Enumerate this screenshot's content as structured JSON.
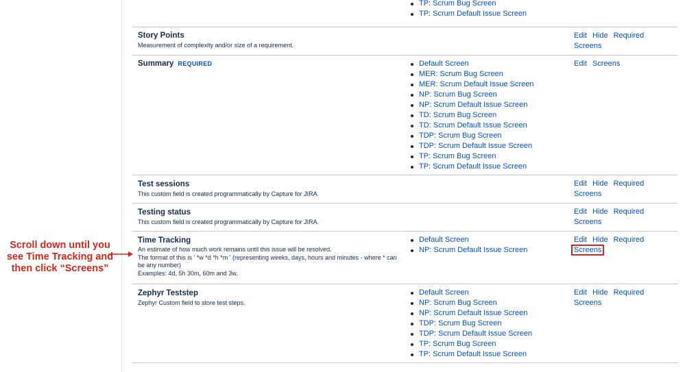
{
  "annotation": {
    "lines": [
      "Scroll down until you",
      "see Time Tracking and",
      "then click “Screens”"
    ]
  },
  "top_partial": {
    "screens": [
      "TP: Scrum Bug Screen",
      "TP: Scrum Default Issue Screen"
    ]
  },
  "fields": [
    {
      "name": "Story Points",
      "description": [
        "Measurement of complexity and/or size of a requirement."
      ],
      "screens": [],
      "ops": {
        "edit": "Edit",
        "hide": "Hide",
        "required": "Required",
        "screens": "Screens"
      }
    },
    {
      "name": "Summary",
      "required_tag": "REQUIRED",
      "description": [],
      "screens": [
        "Default Screen",
        "MER: Scrum Bug Screen",
        "MER: Scrum Default Issue Screen",
        "NP: Scrum Bug Screen",
        "NP: Scrum Default Issue Screen",
        "TD: Scrum Bug Screen",
        "TD: Scrum Default Issue Screen",
        "TDP: Scrum Bug Screen",
        "TDP: Scrum Default Issue Screen",
        "TP: Scrum Bug Screen",
        "TP: Scrum Default Issue Screen"
      ],
      "ops": {
        "edit": "Edit",
        "screens": "Screens"
      }
    },
    {
      "name": "Test sessions",
      "description": [
        "This custom field is created programmatically by Capture for JIRA."
      ],
      "screens": [],
      "ops": {
        "edit": "Edit",
        "hide": "Hide",
        "required": "Required",
        "screens": "Screens"
      }
    },
    {
      "name": "Testing status",
      "description": [
        "This custom field is created programmatically by Capture for JIRA."
      ],
      "screens": [],
      "ops": {
        "edit": "Edit",
        "hide": "Hide",
        "required": "Required",
        "screens": "Screens"
      }
    },
    {
      "name": "Time Tracking",
      "description": [
        "An estimate of how much work remains until this issue will be resolved.",
        "The format of this is ' *w *d *h *m ' (representing weeks, days, hours and minutes - where * can",
        "be any number)",
        "Examples: 4d, 5h 30m, 60m and 3w."
      ],
      "screens": [
        "Default Screen",
        "NP: Scrum Default Issue Screen"
      ],
      "ops": {
        "edit": "Edit",
        "hide": "Hide",
        "required": "Required",
        "screens": "Screens"
      }
    },
    {
      "name": "Zephyr Teststep",
      "description": [
        "Zephyr Custom field to store test steps."
      ],
      "screens": [
        "Default Screen",
        "NP: Scrum Bug Screen",
        "NP: Scrum Default Issue Screen",
        "TDP: Scrum Bug Screen",
        "TDP: Scrum Default Issue Screen",
        "TP: Scrum Bug Screen",
        "TP: Scrum Default Issue Screen"
      ],
      "ops": {
        "edit": "Edit",
        "hide": "Hide",
        "required": "Required",
        "screens": "Screens"
      }
    }
  ],
  "colors": {
    "link": "#0052cc",
    "annotation": "#d9261c",
    "highlight_box": "#e2241b"
  }
}
